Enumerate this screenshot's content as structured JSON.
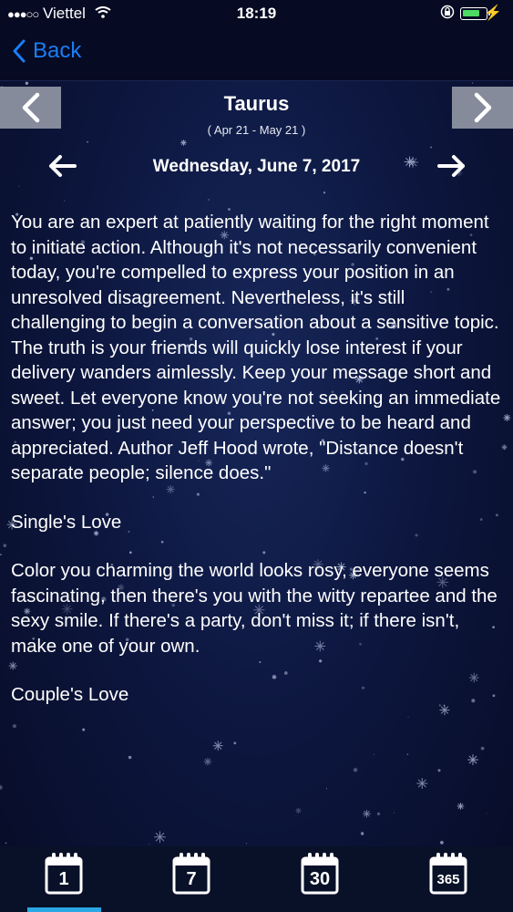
{
  "status": {
    "carrier": "Viettel",
    "time": "18:19",
    "battery_level": 0.8
  },
  "nav": {
    "back_label": "Back"
  },
  "sign": {
    "name": "Taurus",
    "range": "( Apr 21 - May 21 )"
  },
  "date": "Wednesday, June 7, 2017",
  "horoscope": {
    "daily_text": "You are an expert at patiently waiting for the right moment to initiate action. Although it's not necessarily convenient today, you're compelled to express your position in an unresolved disagreement. Nevertheless, it's still challenging to begin a conversation about a sensitive topic. The truth is your friends will quickly lose interest if your delivery wanders aimlessly. Keep your message short and sweet. Let everyone know you're not seeking an immediate answer; you just need your perspective to be heard and appreciated.  Author Jeff Hood wrote, \"Distance doesn't separate people; silence does.\"",
    "singles_title": "Single's Love",
    "singles_text": "Color you charming  the world looks rosy, everyone seems fascinating, then there's you with the witty repartee and the sexy smile. If there's a party, don't miss it; if there isn't, make one of your own.",
    "couples_title": "Couple's Love"
  },
  "tabs": [
    {
      "label": "1",
      "selected": true
    },
    {
      "label": "7",
      "selected": false
    },
    {
      "label": "30",
      "selected": false
    },
    {
      "label": "365",
      "selected": false
    }
  ],
  "colors": {
    "accent": "#1a7ef5",
    "tab_indicator": "#2aa8e6",
    "background": "#0a1030"
  }
}
